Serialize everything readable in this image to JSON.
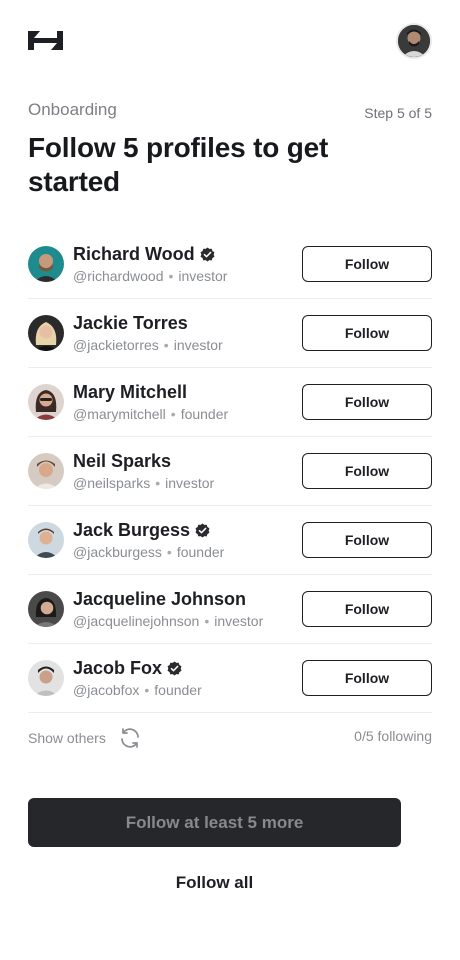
{
  "header": {
    "logo_icon": "h-logo-icon",
    "avatar_icon": "user-avatar"
  },
  "onboarding": {
    "section_label": "Onboarding",
    "step": "Step 5 of 5",
    "title": "Follow 5 profiles to get started"
  },
  "profiles": [
    {
      "name": "Richard Wood",
      "handle": "@richardwood",
      "role": "investor",
      "verified": true,
      "follow_label": "Follow",
      "avatar_bg": "#1e8c8f"
    },
    {
      "name": "Jackie Torres",
      "handle": "@jackietorres",
      "role": "investor",
      "verified": false,
      "follow_label": "Follow",
      "avatar_bg": "#2a2a2a"
    },
    {
      "name": "Mary Mitchell",
      "handle": "@marymitchell",
      "role": "founder",
      "verified": false,
      "follow_label": "Follow",
      "avatar_bg": "#d9d0cb"
    },
    {
      "name": "Neil Sparks",
      "handle": "@neilsparks",
      "role": "investor",
      "verified": false,
      "follow_label": "Follow",
      "avatar_bg": "#cfc6be"
    },
    {
      "name": "Jack Burgess",
      "handle": "@jackburgess",
      "role": "founder",
      "verified": true,
      "follow_label": "Follow",
      "avatar_bg": "#c8d3dd"
    },
    {
      "name": "Jacqueline Johnson",
      "handle": "@jacquelinejohnson",
      "role": "investor",
      "verified": false,
      "follow_label": "Follow",
      "avatar_bg": "#4a4a4a"
    },
    {
      "name": "Jacob Fox",
      "handle": "@jacobfox",
      "role": "founder",
      "verified": true,
      "follow_label": "Follow",
      "avatar_bg": "#dcdcdc"
    }
  ],
  "footer": {
    "show_others": "Show others",
    "following_count": "0/5 following",
    "primary_button": "Follow at least 5 more",
    "follow_all": "Follow all"
  },
  "colors": {
    "text": "#1d1f24",
    "muted": "#8a8d93",
    "primary_bg": "#26272b",
    "primary_text": "#87898d"
  }
}
